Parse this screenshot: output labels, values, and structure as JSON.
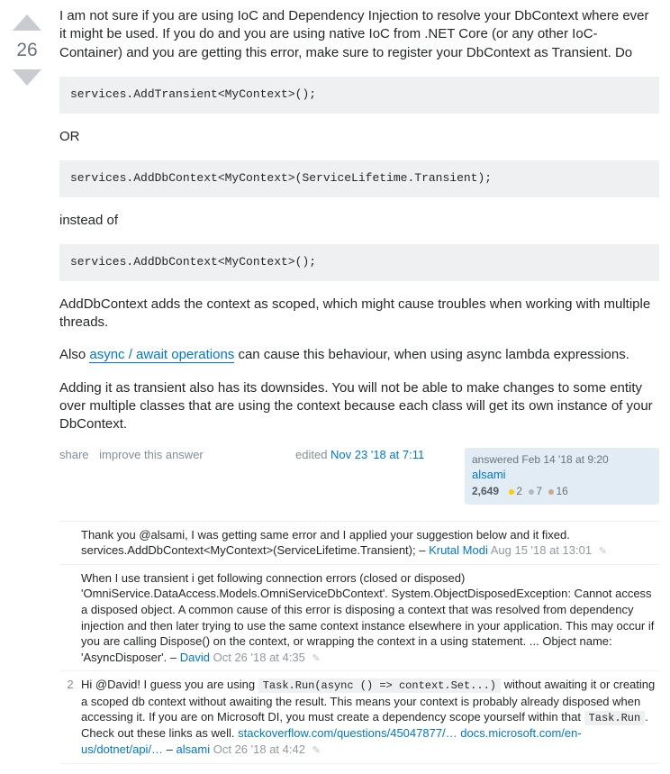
{
  "vote": {
    "count": "26"
  },
  "post": {
    "p1": "I am not sure if you are using IoC and Dependency Injection to resolve your DbContext where ever it might be used. If you do and you are using native IoC from .NET Core (or any other IoC-Container) and you are getting this error, make sure to register your DbContext as Transient. Do",
    "code1": "services.AddTransient<MyContext>();",
    "p2": "OR",
    "code2": "services.AddDbContext<MyContext>(ServiceLifetime.Transient);",
    "p3": "instead of",
    "code3": "services.AddDbContext<MyContext>();",
    "p4": "AddDbContext adds the context as scoped, which might cause troubles when working with multiple threads.",
    "p5a": "Also ",
    "p5link": "async / await operations",
    "p5b": " can cause this behaviour, when using async lambda expressions.",
    "p6": "Adding it as transient also has its downsides. You will not be able to make changes to some entity over multiple classes that are using the context because each class will get its own instance of your DbContext."
  },
  "actions": {
    "share": "share",
    "improve": "improve this answer"
  },
  "edited": {
    "prefix": "edited ",
    "when": "Nov 23 '18 at 7:11"
  },
  "usercard": {
    "when": "answered Feb 14 '18 at 9:20",
    "name": "alsami",
    "rep": "2,649",
    "gold": "2",
    "silver": "7",
    "bronze": "16"
  },
  "comments": [
    {
      "score": "",
      "text": "Thank you @alsami, I was getting same error and I applied your suggestion below and it fixed. services.AddDbContext<MyContext>(ServiceLifetime.Transient); – ",
      "user": "Krutal Modi",
      "time": "Aug 15 '18 at 13:01",
      "pencil": true
    },
    {
      "score": "",
      "text": "When I use transient i get following connection errors (closed or disposed) 'OmniService.DataAccess.Models.OmniServiceDbContext'. System.ObjectDisposedException: Cannot access a disposed object. A common cause of this error is disposing a context that was resolved from dependency injection and then later trying to use the same context instance elsewhere in your application. This may occur if you are calling Dispose() on the context, or wrapping the context in a using statement. ... Object name: 'AsyncDisposer'. – ",
      "user": "David",
      "time": "Oct 26 '18 at 4:35",
      "pencil": true
    },
    {
      "score": "2",
      "pre": "Hi @David! I guess you are using ",
      "code": "Task.Run(async () => context.Set...)",
      "post": " without awaiting it or creating a scoped db context without awaiting the result. This means your context is probably already disposed when accessing it. If you are on Microsoft DI, you must create a dependency scope yourself within that ",
      "code2": "Task.Run",
      "post2": ". Check out these links as well. ",
      "link1": "stackoverflow.com/questions/45047877/…",
      "link2": "docs.microsoft.com/en-us/dotnet/api/…",
      "dash": " – ",
      "user": "alsami",
      "time": "Oct 26 '18 at 4:42",
      "pencil": true
    }
  ]
}
